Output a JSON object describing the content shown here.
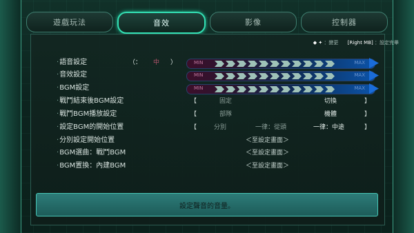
{
  "tabs": [
    {
      "label": "遊戲玩法",
      "active": false
    },
    {
      "label": "音效",
      "active": true
    },
    {
      "label": "影像",
      "active": false
    },
    {
      "label": "控制器",
      "active": false
    }
  ],
  "hint": {
    "keys": "◆ ✦",
    "change": "：變更",
    "confirm_key": "[Right MB]",
    "confirm": "：設定完畢"
  },
  "rows": {
    "voice": {
      "label": "語音設定",
      "bracket_left": "（：",
      "value": "中",
      "bracket_right": "）"
    },
    "sfx": {
      "label": "音效設定"
    },
    "bgm": {
      "label": "BGM設定"
    },
    "after_battle": {
      "label": "戰鬥結束後BGM設定",
      "opt1": "固定",
      "opt2": "切換"
    },
    "battle_play": {
      "label": "戰鬥BGM播放設定",
      "opt1": "部隊",
      "opt2": "機體"
    },
    "start_pos": {
      "label": "設定BGM的開始位置",
      "opt1": "分別",
      "opt2": "一律：從頭",
      "opt3": "一律：中途"
    },
    "per_start": {
      "label": "分別設定開始位置",
      "link": "＜至設定畫面＞"
    },
    "bgm_select": {
      "label": "BGM選曲：戰鬥BGM",
      "link": "＜至設定畫面＞"
    },
    "bgm_replace": {
      "label": "BGM置換：內建BGM",
      "link": "＜至設定畫面＞"
    }
  },
  "slider": {
    "min": "MIN",
    "max": "MAX"
  },
  "levels": {
    "sfx": 0.9,
    "bgm": 0.9,
    "voice_level": 0.9
  },
  "info": "設定聲音的音量。",
  "colors": {
    "accent": "#34e0b4",
    "panel": "#12261f"
  }
}
